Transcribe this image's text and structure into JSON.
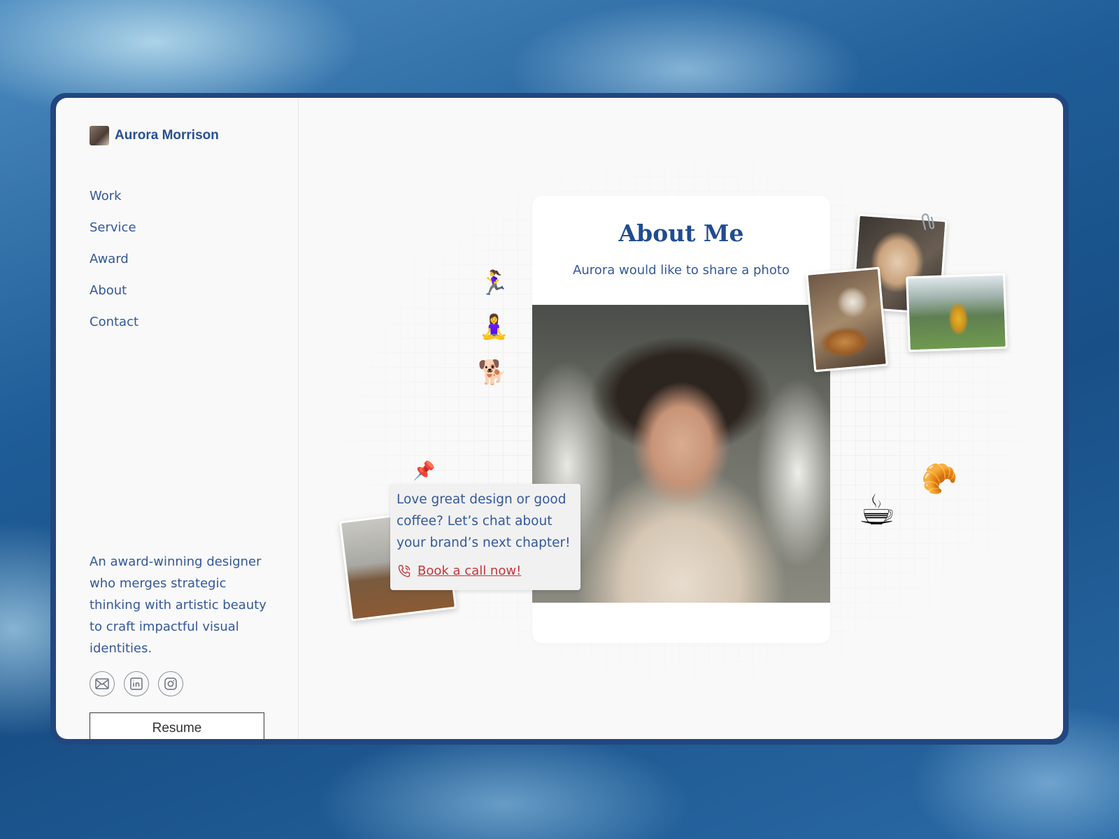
{
  "brand": {
    "name": "Aurora Morrison"
  },
  "nav": [
    {
      "label": "Work"
    },
    {
      "label": "Service"
    },
    {
      "label": "Award"
    },
    {
      "label": "About"
    },
    {
      "label": "Contact"
    }
  ],
  "bio": "An award-winning designer who merges strategic thinking with artistic beauty to craft impactful visual identities.",
  "socials": [
    {
      "icon": "mail-icon"
    },
    {
      "icon": "linkedin-icon"
    },
    {
      "icon": "instagram-icon"
    }
  ],
  "resume_label": "Resume",
  "about": {
    "title": "About Me",
    "subtitle": "Aurora would like to share a photo"
  },
  "note": {
    "text": "Love great design or good coffee? Let’s chat about your brand’s next chapter!",
    "link_label": "Book a call now!"
  },
  "emojis": {
    "runner": "🏃‍♀️",
    "yoga": "🧘‍♀️",
    "dog": "🐕",
    "croissant": "🥐",
    "coffee": "☕",
    "pin": "📌"
  },
  "colors": {
    "accent": "#214b92",
    "text": "#34589a",
    "link": "#c5363a",
    "frame": "#22467f"
  }
}
